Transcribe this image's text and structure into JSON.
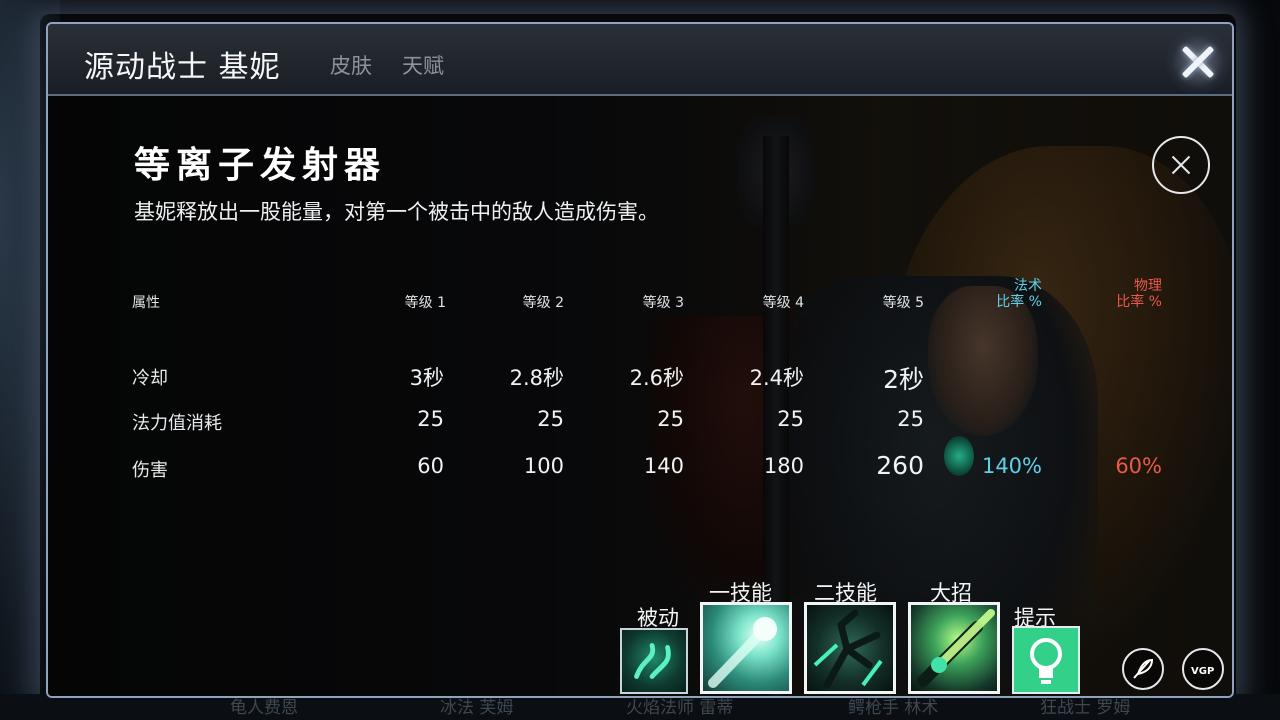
{
  "hero": {
    "title": "源动战士 基妮"
  },
  "tabs": {
    "skin": "皮肤",
    "talent": "天赋"
  },
  "skill": {
    "name": "等离子发射器",
    "description": "基妮释放出一股能量，对第一个被击中的敌人造成伤害。"
  },
  "table": {
    "attr_header": "属性",
    "level_headers": [
      "等级 1",
      "等级 2",
      "等级 3",
      "等级 4",
      "等级 5"
    ],
    "magic_ratio": {
      "line1": "法术",
      "line2": "比率 %"
    },
    "phys_ratio": {
      "line1": "物理",
      "line2": "比率 %"
    },
    "rows": [
      {
        "label": "冷却",
        "values": [
          "3秒",
          "2.8秒",
          "2.6秒",
          "2.4秒",
          "2秒"
        ]
      },
      {
        "label": "法力值消耗",
        "values": [
          "25",
          "25",
          "25",
          "25",
          "25"
        ]
      },
      {
        "label": "伤害",
        "values": [
          "60",
          "100",
          "140",
          "180",
          "260"
        ],
        "magic": "140%",
        "phys": "60%"
      }
    ]
  },
  "skillbar": {
    "passive": "被动",
    "skill1": "一技能",
    "skill2": "二技能",
    "ultimate": "大招",
    "tip": "提示"
  },
  "background_nav": [
    "龟人费恩",
    "冰法 芙姆",
    "火焰法师 雷蒂",
    "鳄枪手 林术",
    "狂战士 罗姆"
  ],
  "colors": {
    "magic": "#5fd0e8",
    "physical": "#e85a4a",
    "tip_icon": "#33d08a"
  },
  "icons": [
    "close-icon",
    "feather-icon",
    "vgp-icon",
    "lightbulb-icon"
  ]
}
